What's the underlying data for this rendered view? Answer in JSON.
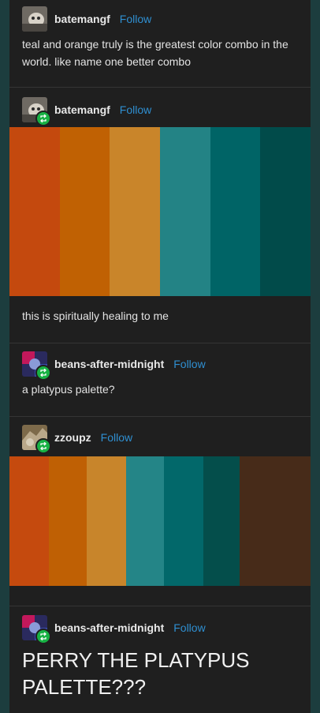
{
  "posts": [
    {
      "username": "batemangf",
      "follow": "Follow",
      "text": "teal and orange truly is the greatest color combo in the world. like name one better combo"
    },
    {
      "username": "batemangf",
      "follow": "Follow",
      "palette": [
        "#c4490e",
        "#c06103",
        "#c9852a",
        "#238385",
        "#006466",
        "#014b4a"
      ],
      "text": "this is spiritually healing to me"
    },
    {
      "username": "beans-after-midnight",
      "follow": "Follow",
      "text": "a platypus palette?"
    },
    {
      "username": "zzoupz",
      "follow": "Follow",
      "palette": [
        "#c54a0e",
        "#bf6004",
        "#c8852b",
        "#248587",
        "#02686a",
        "#044e4b",
        "#472b19"
      ]
    },
    {
      "username": "beans-after-midnight",
      "follow": "Follow",
      "text": "PERRY THE PLATYPUS PALETTE???"
    }
  ],
  "colors": {
    "background": "#1c3d3e",
    "panel": "#1f1f1f",
    "follow_link": "#2f8fd1",
    "reblog_badge": "#18b244"
  },
  "icons": {
    "reblog_badge": "reblog-icon"
  }
}
